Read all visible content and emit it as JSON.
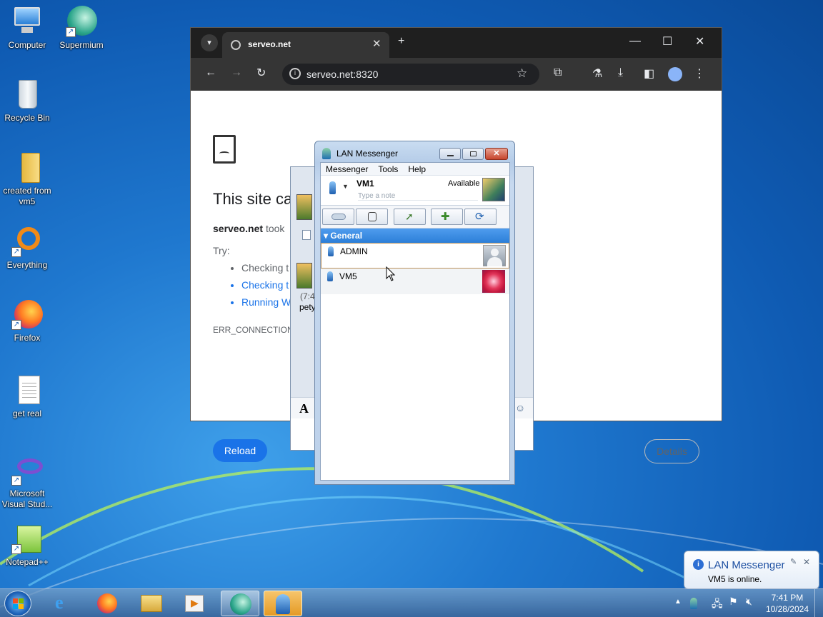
{
  "desktop": {
    "icons": [
      {
        "label": "Computer"
      },
      {
        "label": "Supermium"
      },
      {
        "label": "Recycle Bin"
      },
      {
        "label": "created from vm5"
      },
      {
        "label": "Everything"
      },
      {
        "label": "Firefox"
      },
      {
        "label": "get real"
      },
      {
        "label": "Microsoft Visual Stud..."
      },
      {
        "label": "Notepad++"
      }
    ]
  },
  "browser": {
    "tab_title": "serveo.net",
    "address": "serveo.net:8320",
    "error_title": "This site ca",
    "error_host": "serveo.net",
    "error_text": "took",
    "try_label": "Try:",
    "suggestions": [
      "Checking t",
      "Checking t",
      "Running W"
    ],
    "error_code": "ERR_CONNECTION_T",
    "reload_label": "Reload",
    "details_label": "Details"
  },
  "chat_window": {
    "time": "(7:4",
    "sender": "pety",
    "font_button": "A"
  },
  "lan_messenger": {
    "title": "LAN Messenger",
    "menu": [
      "Messenger",
      "Tools",
      "Help"
    ],
    "user": {
      "name": "VM1",
      "status": "Available",
      "note_placeholder": "Type a note"
    },
    "group": "General",
    "contacts": [
      {
        "name": "ADMIN"
      },
      {
        "name": "VM5"
      }
    ]
  },
  "notification": {
    "title": "LAN Messenger",
    "message": "VM5 is online."
  },
  "taskbar": {
    "time": "7:41 PM",
    "date": "10/28/2024"
  },
  "colors": {
    "accent": "#1a73e8",
    "group_header": "#3a8be2",
    "desktop": "#1f78cf"
  }
}
